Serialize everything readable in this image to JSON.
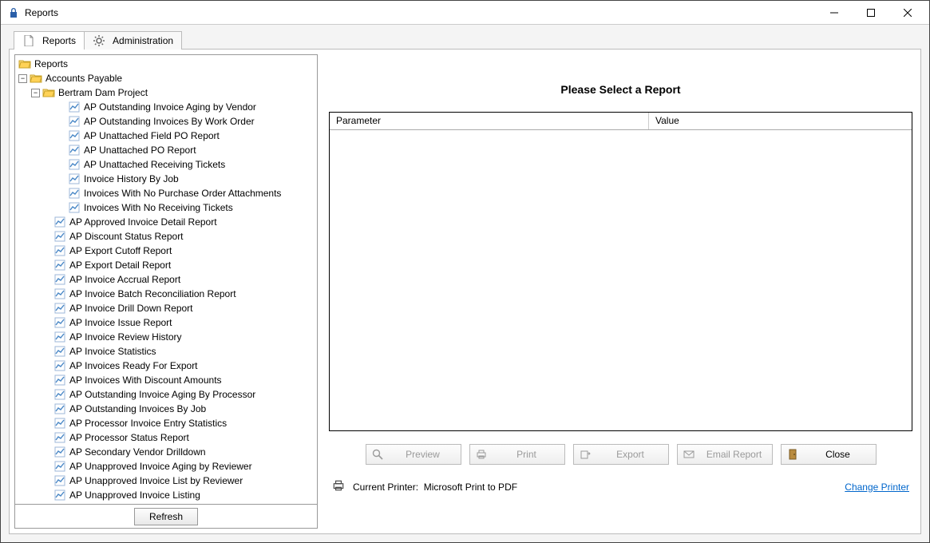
{
  "window": {
    "title": "Reports"
  },
  "tabs": [
    {
      "label": "Reports",
      "icon": "document-icon",
      "active": true
    },
    {
      "label": "Administration",
      "icon": "gear-icon",
      "active": false
    }
  ],
  "tree": {
    "root": {
      "label": "Reports"
    },
    "ap": {
      "label": "Accounts Payable"
    },
    "project": {
      "label": "Bertram Dam Project"
    },
    "project_reports": [
      "AP Outstanding Invoice Aging by Vendor",
      "AP Outstanding Invoices By Work Order",
      "AP Unattached Field PO Report",
      "AP Unattached PO Report",
      "AP Unattached Receiving Tickets",
      "Invoice History By Job",
      "Invoices With No Purchase Order Attachments",
      "Invoices With No Receiving Tickets"
    ],
    "ap_reports": [
      "AP Approved Invoice Detail Report",
      "AP Discount Status Report",
      "AP Export Cutoff Report",
      "AP Export Detail Report",
      "AP Invoice Accrual Report",
      "AP Invoice Batch Reconciliation Report",
      "AP Invoice Drill Down Report",
      "AP Invoice Issue Report",
      "AP Invoice Review History",
      "AP Invoice Statistics",
      "AP Invoices Ready For Export",
      "AP Invoices With Discount Amounts",
      "AP Outstanding Invoice Aging By Processor",
      "AP Outstanding Invoices By Job",
      "AP Processor Invoice Entry Statistics",
      "AP Processor Status Report",
      "AP Secondary Vendor Drilldown",
      "AP Unapproved Invoice Aging by Reviewer",
      "AP Unapproved Invoice List by Reviewer",
      "AP Unapproved Invoice Listing"
    ]
  },
  "buttons": {
    "refresh": "Refresh",
    "preview": "Preview",
    "print": "Print",
    "export": "Export",
    "email": "Email Report",
    "close": "Close"
  },
  "right_panel": {
    "prompt": "Please Select a Report",
    "col_parameter": "Parameter",
    "col_value": "Value"
  },
  "footer": {
    "printer_label": "Current Printer:",
    "printer_name": "Microsoft Print to PDF",
    "change_link": "Change Printer"
  }
}
